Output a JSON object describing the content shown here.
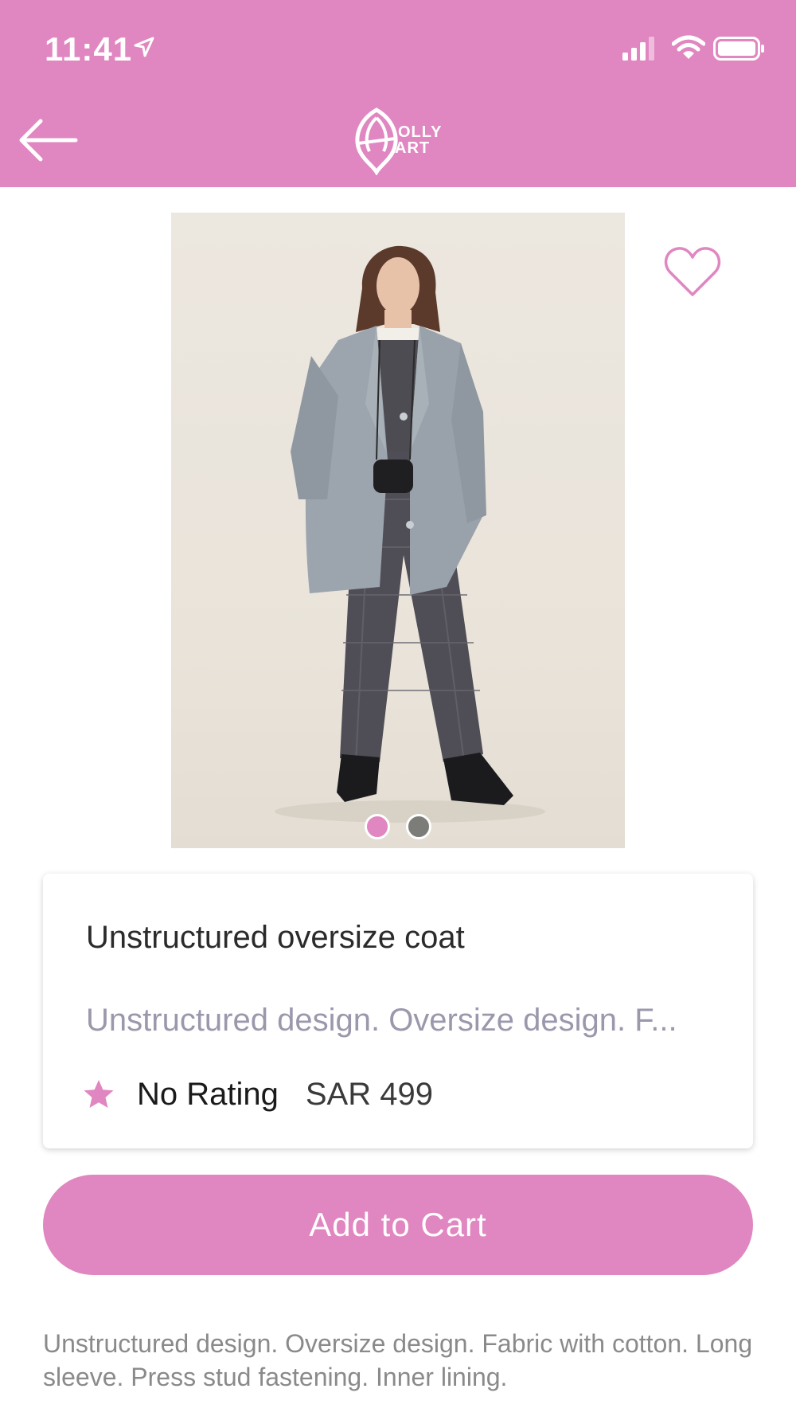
{
  "status_bar": {
    "time": "11:41",
    "icons": [
      "location-arrow-icon",
      "signal-icon",
      "wifi-icon",
      "battery-icon"
    ]
  },
  "nav": {
    "back_icon": "arrow-left-icon",
    "logo_line1": "OLLY",
    "logo_line2": "ART"
  },
  "gallery": {
    "image_count": 2,
    "active_index": 0,
    "favorite_icon": "heart-outline-icon"
  },
  "product": {
    "name": "Unstructured oversize coat",
    "short_description": "Unstructured design. Oversize design. F...",
    "rating_icon": "star-icon",
    "rating_text": "No Rating",
    "price": "SAR 499",
    "long_description": "Unstructured design. Oversize design. Fabric with cotton. Long sleeve. Press stud fastening. Inner lining."
  },
  "actions": {
    "add_to_cart_label": "Add to Cart"
  },
  "colors": {
    "brand_pink": "#e086c0",
    "inactive_dot": "#7c7d78",
    "muted_text": "#9b98ac"
  }
}
